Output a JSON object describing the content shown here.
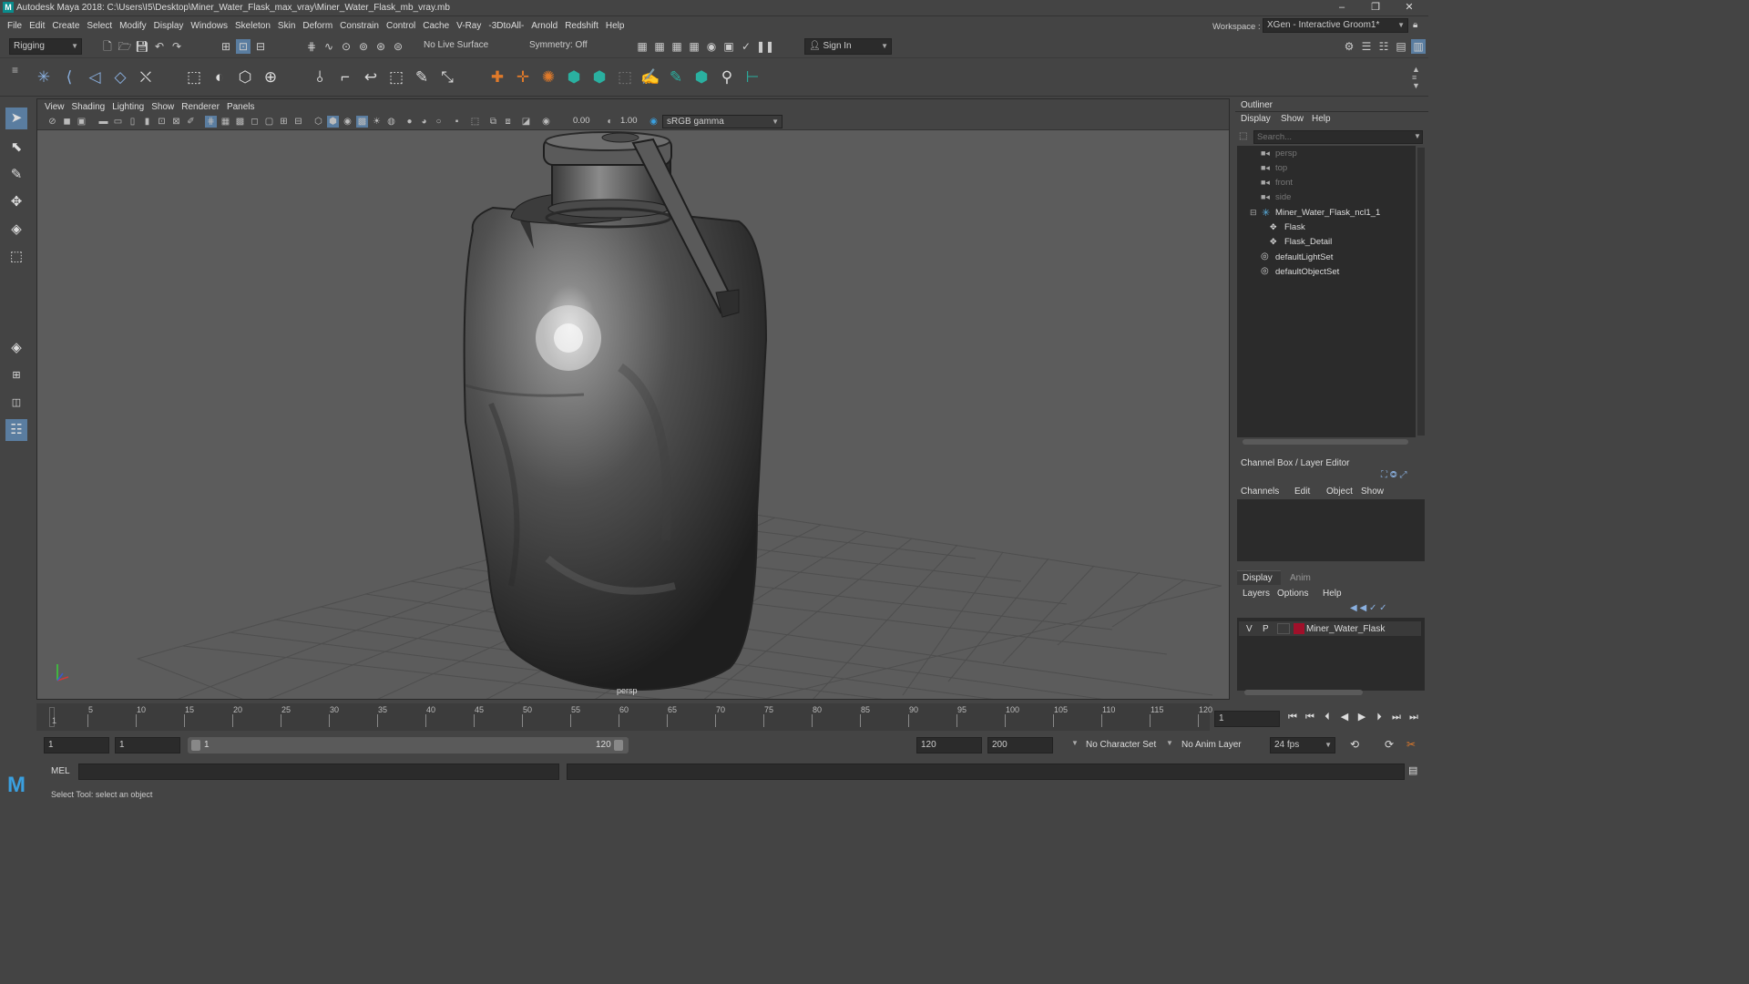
{
  "titlebar": {
    "title": "Autodesk Maya 2018: C:\\Users\\I5\\Desktop\\Miner_Water_Flask_max_vray\\Miner_Water_Flask_mb_vray.mb",
    "logo": "M"
  },
  "menubar": {
    "items": [
      "File",
      "Edit",
      "Create",
      "Select",
      "Modify",
      "Display",
      "Windows",
      "Skeleton",
      "Skin",
      "Deform",
      "Constrain",
      "Control",
      "Cache",
      "V-Ray",
      "-3DtoAll-",
      "Arnold",
      "Redshift",
      "Help"
    ],
    "workspace_label": "Workspace :",
    "workspace_value": "XGen - Interactive Groom1*"
  },
  "shelf": {
    "mode": "Rigging",
    "live_surface": "No Live Surface",
    "symmetry": "Symmetry: Off",
    "sign_in": "Sign In"
  },
  "viewport": {
    "menu": [
      "View",
      "Shading",
      "Lighting",
      "Show",
      "Renderer",
      "Panels"
    ],
    "exposure": "0.00",
    "gamma": "1.00",
    "color_space": "sRGB gamma",
    "camera_label": "persp"
  },
  "outliner": {
    "title": "Outliner",
    "menu": [
      "Display",
      "Show",
      "Help"
    ],
    "search_placeholder": "Search...",
    "items": [
      {
        "label": "persp",
        "dim": true
      },
      {
        "label": "top",
        "dim": true
      },
      {
        "label": "front",
        "dim": true
      },
      {
        "label": "side",
        "dim": true
      },
      {
        "label": "Miner_Water_Flask_ncl1_1",
        "dim": false
      },
      {
        "label": "Flask",
        "dim": false
      },
      {
        "label": "Flask_Detail",
        "dim": false
      },
      {
        "label": "defaultLightSet",
        "dim": false
      },
      {
        "label": "defaultObjectSet",
        "dim": false
      }
    ]
  },
  "channelbox": {
    "title": "Channel Box / Layer Editor",
    "menu": [
      "Channels",
      "Edit",
      "Object",
      "Show"
    ],
    "tabs": [
      "Display",
      "Anim"
    ],
    "layer_menu": [
      "Layers",
      "Options",
      "Help"
    ],
    "layer": {
      "v": "V",
      "p": "P",
      "name": "Miner_Water_Flask",
      "color": "#a0102a"
    }
  },
  "timeline": {
    "ticks": [
      "1",
      "5",
      "10",
      "15",
      "20",
      "25",
      "30",
      "35",
      "40",
      "45",
      "50",
      "55",
      "60",
      "65",
      "70",
      "75",
      "80",
      "85",
      "90",
      "95",
      "100",
      "105",
      "110",
      "115",
      "120"
    ],
    "current_frame": "1"
  },
  "range": {
    "start": "1",
    "start2": "1",
    "slider_start": "1",
    "slider_end": "120",
    "end": "120",
    "end2": "200",
    "character_set": "No Character Set",
    "anim_layer": "No Anim Layer",
    "fps": "24 fps"
  },
  "cmdline": {
    "label": "MEL"
  },
  "help": {
    "text": "Select Tool: select an object"
  }
}
